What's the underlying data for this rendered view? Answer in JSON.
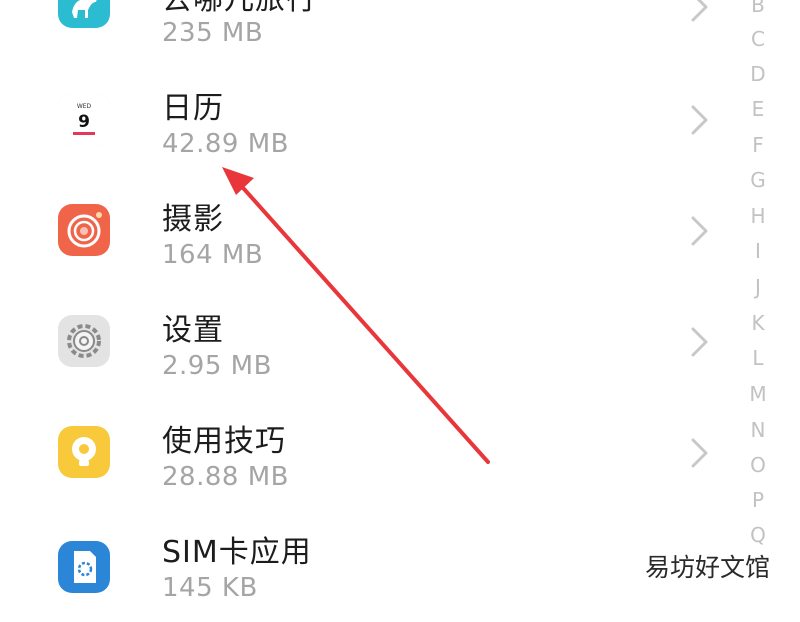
{
  "apps": [
    {
      "name": "去哪儿旅行",
      "size": "235 MB",
      "icon": "camel-icon",
      "accent": "#2bbcd2"
    },
    {
      "name": "日历",
      "size": "42.89 MB",
      "icon": "calendar-icon",
      "day": "9",
      "accent": "#e6375a"
    },
    {
      "name": "摄影",
      "size": "164 MB",
      "icon": "camera-icon",
      "accent": "#f0654a"
    },
    {
      "name": "设置",
      "size": "2.95 MB",
      "icon": "gear-icon",
      "accent": "#e3e3e3"
    },
    {
      "name": "使用技巧",
      "size": "28.88 MB",
      "icon": "lightbulb-icon",
      "accent": "#f8c93a"
    },
    {
      "name": "SIM卡应用",
      "size": "145 KB",
      "icon": "sim-card-icon",
      "accent": "#2b86d8"
    }
  ],
  "index_letters": [
    "B",
    "C",
    "D",
    "E",
    "F",
    "G",
    "H",
    "I",
    "J",
    "K",
    "L",
    "M",
    "N",
    "O",
    "P",
    "Q"
  ],
  "watermark": "易坊好文馆",
  "colors": {
    "arrow": "#e8363b",
    "chevron": "#c8c8c8",
    "name_text": "#1c1c1c",
    "size_text": "#a5a5a5"
  }
}
